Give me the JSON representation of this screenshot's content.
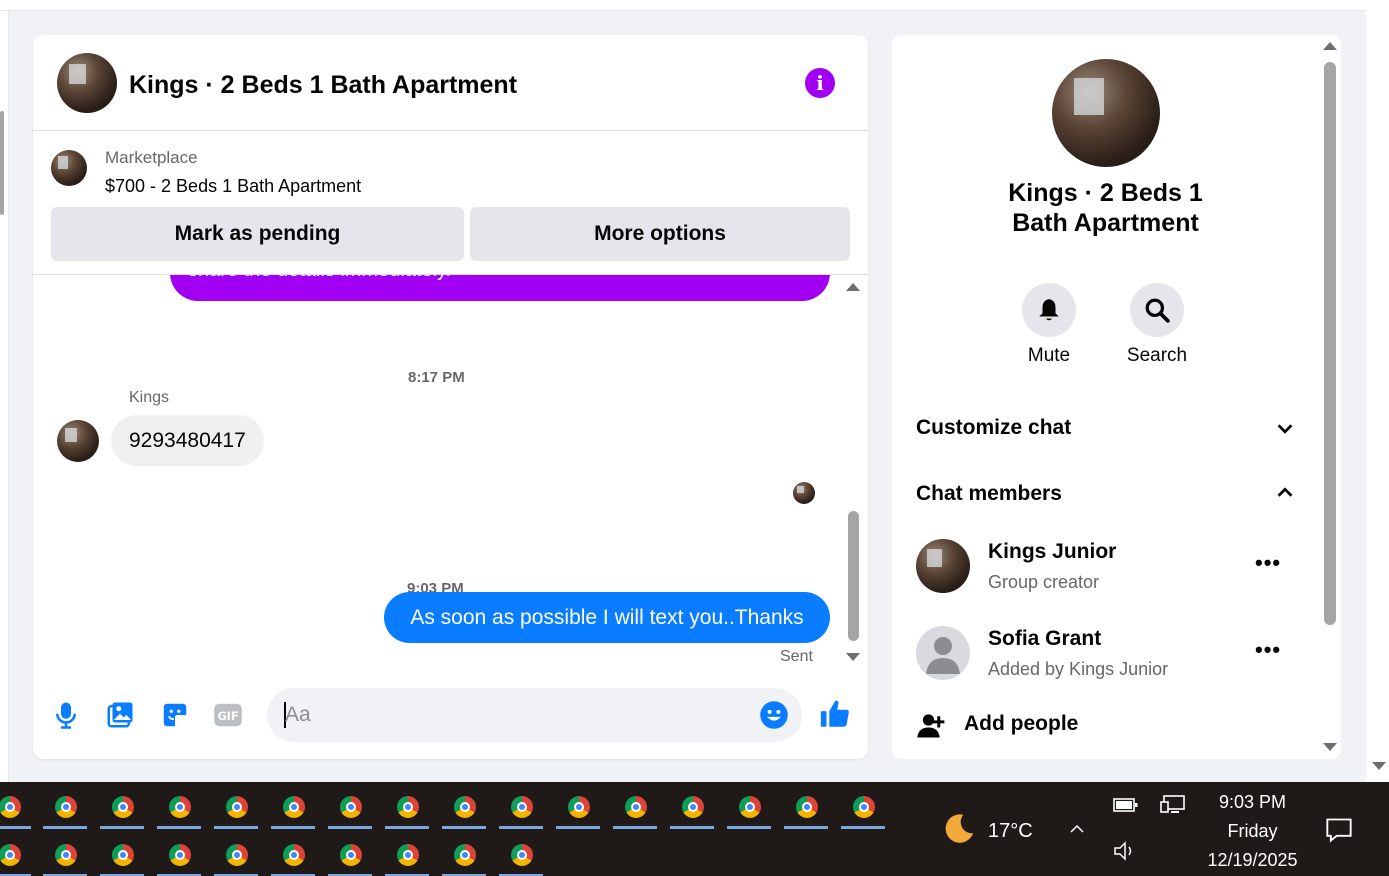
{
  "chat": {
    "title": "Kings · 2 Beds 1 Bath Apartment",
    "listing_source": "Marketplace",
    "listing_title": "$700 - 2 Beds 1 Bath Apartment",
    "mark_pending_label": "Mark as pending",
    "more_options_label": "More options",
    "messages": [
      {
        "type": "outgoing_partial",
        "text": "share the details immediately."
      },
      {
        "type": "timestamp",
        "text": "8:17 PM"
      },
      {
        "type": "incoming",
        "sender": "Kings",
        "text": "9293480417"
      },
      {
        "type": "timestamp",
        "text": "9:03 PM"
      },
      {
        "type": "outgoing",
        "text": "As soon as possible I will text you..Thanks",
        "status": "Sent"
      }
    ],
    "composer": {
      "placeholder": "Aa"
    },
    "colors": {
      "accent_purple": "#a100f2",
      "outgoing_blue": "#0a7cff",
      "icon_blue": "#0a7cff"
    }
  },
  "info_panel": {
    "title": "Kings · 2 Beds 1 Bath Apartment",
    "mute_label": "Mute",
    "search_label": "Search",
    "customize_chat_label": "Customize chat",
    "chat_members_label": "Chat members",
    "members": [
      {
        "name": "Kings Junior",
        "role": "Group creator"
      },
      {
        "name": "Sofia Grant",
        "role": "Added by Kings Junior"
      }
    ],
    "add_people_label": "Add people"
  },
  "taskbar": {
    "weather_temp": "17°C",
    "time": "9:03 PM",
    "day": "Friday",
    "date": "12/19/2025"
  }
}
